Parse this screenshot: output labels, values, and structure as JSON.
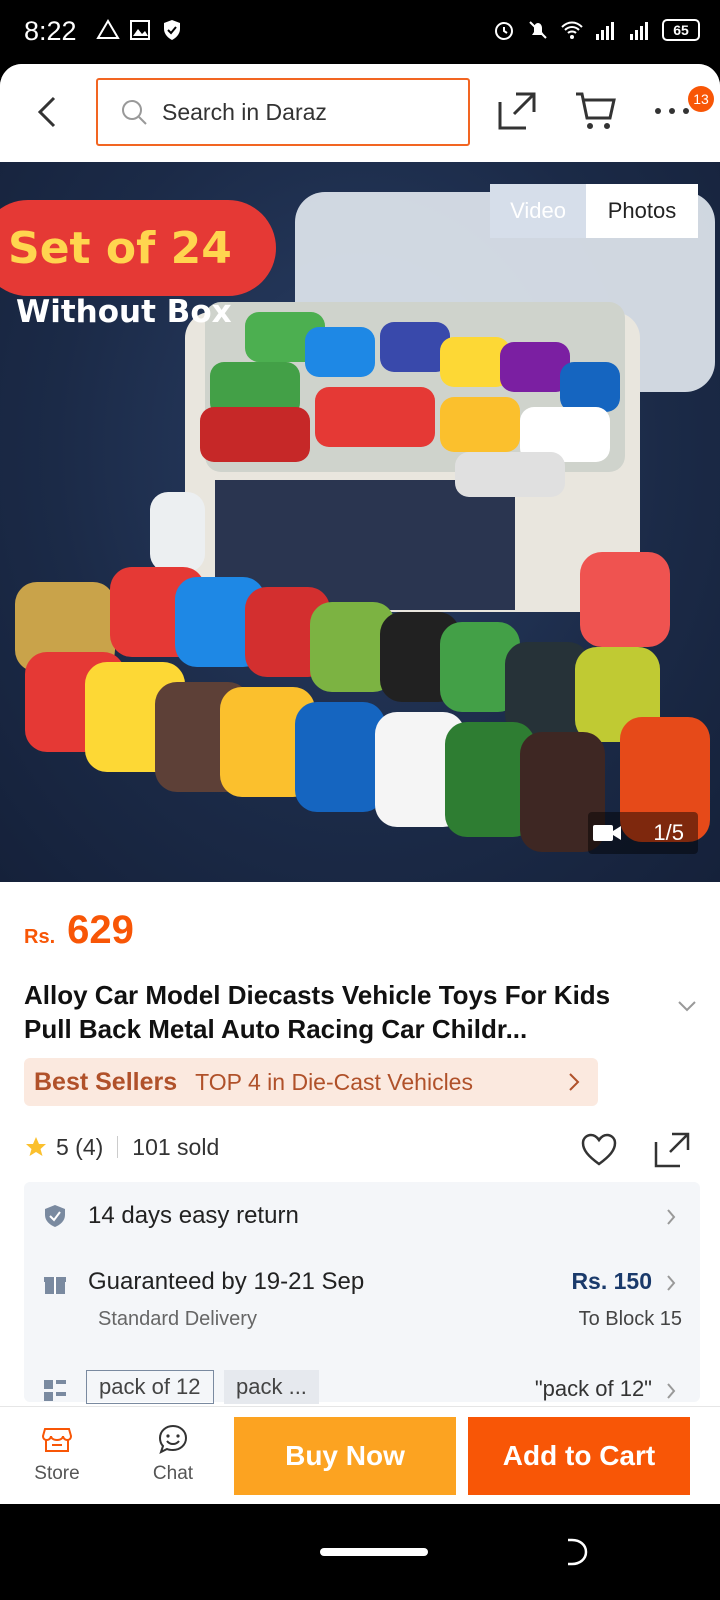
{
  "status_bar": {
    "time": "8:22",
    "battery": "65"
  },
  "header": {
    "search_placeholder": "Search in Daraz",
    "cart_badge": "13"
  },
  "gallery": {
    "promo_title": "Set of 24",
    "promo_subtitle": "Without Box",
    "toggle_video": "Video",
    "toggle_photos": "Photos",
    "counter": "1/5"
  },
  "product": {
    "currency": "Rs.",
    "price": "629",
    "title": "Alloy Car Model Diecasts Vehicle Toys For Kids Pull Back Metal Auto Racing Car Childr...",
    "best_sellers_label": "Best Sellers",
    "best_sellers_text": "TOP 4 in Die-Cast Vehicles",
    "rating": "5 (4)",
    "sold": "101 sold"
  },
  "services": {
    "return_text": "14 days easy return",
    "delivery_text": "Guaranteed by 19-21 Sep",
    "delivery_sub": "Standard Delivery",
    "delivery_price": "Rs. 150",
    "delivery_to": "To Block 15",
    "variant_1": "pack of 12",
    "variant_2": "pack ...",
    "variant_selected": "\"pack of 12\""
  },
  "bottom_bar": {
    "store_label": "Store",
    "chat_label": "Chat",
    "buy_now": "Buy Now",
    "add_to_cart": "Add to Cart"
  },
  "colors": {
    "brand_orange": "#f85606",
    "buy_now_yellow": "#fca321"
  }
}
